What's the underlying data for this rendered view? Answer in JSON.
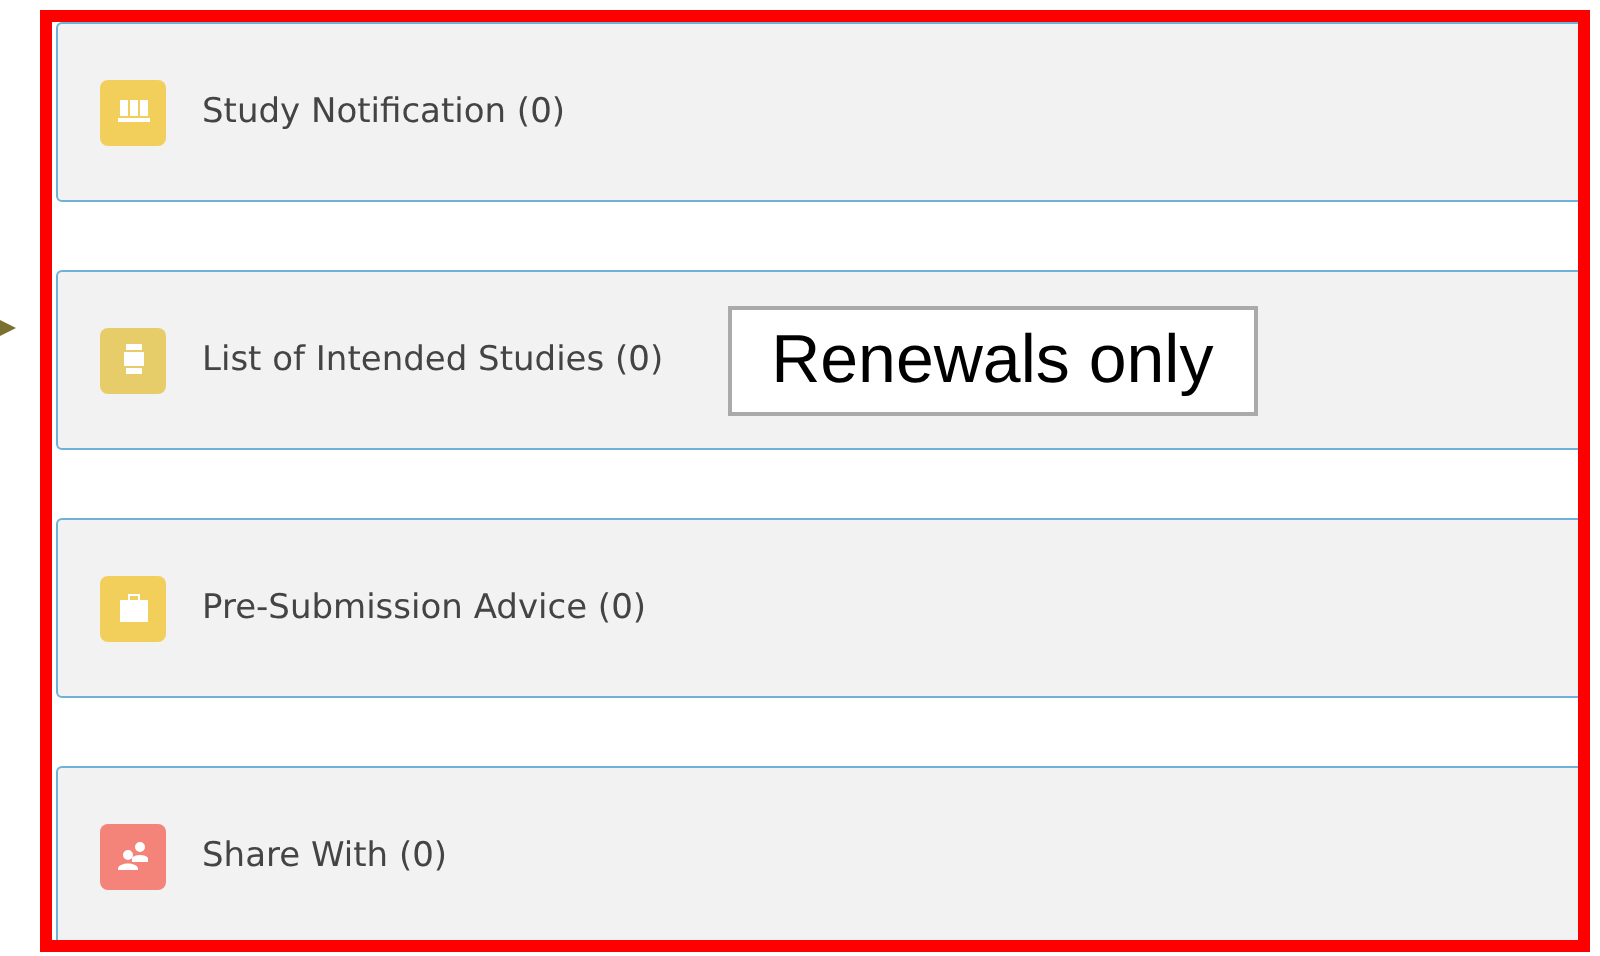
{
  "panels": [
    {
      "label": "Study Notification (0)",
      "kind": "book",
      "color": "#f2cf5b"
    },
    {
      "label": "List of Intended Studies (0)",
      "kind": "list",
      "color": "#e6cd6a",
      "callout": "Renewals only"
    },
    {
      "label": "Pre-Submission Advice (0)",
      "kind": "briefcase",
      "color": "#f2cf5b"
    },
    {
      "label": "Share With (0)",
      "kind": "people",
      "color": "#f4837a"
    }
  ]
}
